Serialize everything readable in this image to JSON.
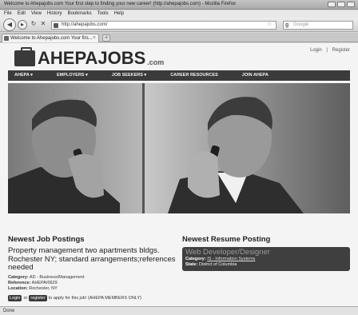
{
  "window": {
    "title": "Welcome to Ahepajobs.com Your first step to finding your new career! (http://ahepajobs.com) - Mozilla Firefox"
  },
  "menu": [
    "File",
    "Edit",
    "View",
    "History",
    "Bookmarks",
    "Tools",
    "Help"
  ],
  "toolbar": {
    "url": "http://ahepajobs.com/",
    "search_placeholder": "Google"
  },
  "tabs": [
    {
      "label": "Welcome to Ahepajobs.com Your firs..."
    }
  ],
  "site": {
    "logo_name": "AHEPAJOBS",
    "logo_suffix": ".com",
    "top_links": [
      "Login",
      "|",
      "Register"
    ],
    "nav": [
      "AHEPA ▾",
      "EMPLOYERS ▾",
      "JOB SEEKERS ▾",
      "CAREER RESOURCES",
      "JOIN AHEPA"
    ]
  },
  "jobs": {
    "heading": "Newest Job Postings",
    "title": "Property management two apartments bldgs. Rochester NY; standard arrangements;references needed",
    "category_label": "Category:",
    "category_value": "AD - Business/Management",
    "reference_label": "Reference:",
    "reference_value": "AHEPA/0629",
    "location_label": "Location:",
    "location_value": "Rochester, NY",
    "login_label": "Login",
    "or_text": "or",
    "register_label": "register",
    "apply_text": "to apply for this job! (AHEPA MEMBERS ONLY)"
  },
  "resume": {
    "heading": "Newest Resume Posting",
    "title": "Web Developer/Designer",
    "category_label": "Category:",
    "category_value": "IS - Information Systems",
    "state_label": "State:",
    "state_value": "District of Columbia"
  },
  "status": {
    "text": "Done"
  }
}
